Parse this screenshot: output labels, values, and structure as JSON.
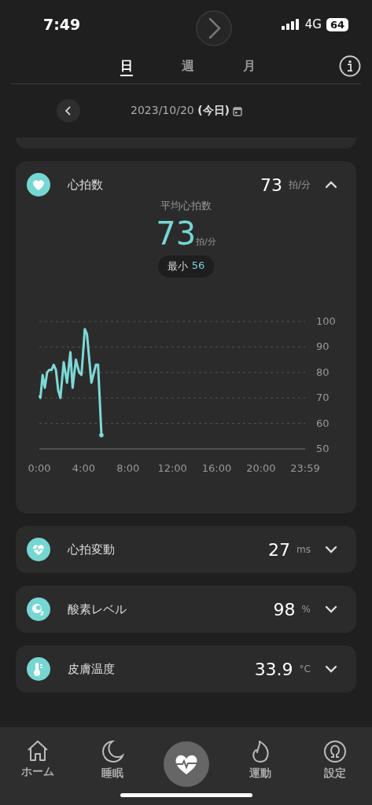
{
  "status_bar": {
    "time": "7:49",
    "network": "4G",
    "battery": "64"
  },
  "tabs": [
    {
      "label": "日",
      "selected": true
    },
    {
      "label": "週",
      "selected": false
    },
    {
      "label": "月",
      "selected": false
    }
  ],
  "date_bar": {
    "date": "2023/10/20",
    "today": "(今日)"
  },
  "metrics": [
    {
      "kind": "heart",
      "label": "心拍数",
      "value": "73",
      "unit": "拍/分",
      "expanded": true,
      "detail": {
        "title": "平均心拍数",
        "value": "73",
        "unit": "拍/分",
        "min_label": "最小",
        "min_value": "56",
        "chart_data": {
          "type": "line",
          "x": [
            0,
            0.1,
            0.3,
            0.5,
            0.7,
            0.9,
            1.1,
            1.3,
            1.5,
            1.7,
            1.9,
            2.2,
            2.5,
            2.8,
            3.0,
            3.3,
            3.6,
            3.8,
            4.1,
            4.3,
            4.7,
            5.1,
            5.3,
            5.6
          ],
          "series": [
            {
              "color": "#7dd9d6",
              "values": [
                71,
                70,
                79,
                74,
                80,
                81,
                81,
                83,
                81,
                73,
                70,
                84,
                76,
                88,
                74,
                85,
                80,
                79,
                97,
                95,
                76,
                83,
                83,
                56
              ]
            }
          ],
          "xlim": [
            0,
            23.98
          ],
          "ylim": [
            50,
            100
          ],
          "xticks": [
            {
              "value": 0,
              "label": "0:00"
            },
            {
              "value": 4,
              "label": "4:00"
            },
            {
              "value": 8,
              "label": "8:00"
            },
            {
              "value": 12,
              "label": "12:00"
            },
            {
              "value": 16,
              "label": "16:00"
            },
            {
              "value": 20,
              "label": "20:00"
            },
            {
              "value": 23.98,
              "label": "23:59"
            }
          ],
          "yticks": [
            50,
            60,
            70,
            80,
            90,
            100
          ],
          "grid": true
        }
      }
    },
    {
      "kind": "hrv",
      "label": "心拍変動",
      "value": "27",
      "unit": "ms",
      "expanded": false
    },
    {
      "kind": "oxygen",
      "label": "酸素レベル",
      "value": "98",
      "unit": "%",
      "expanded": false
    },
    {
      "kind": "temperature",
      "label": "皮膚温度",
      "value": "33.9",
      "unit": "°C",
      "expanded": false
    }
  ],
  "nav": [
    {
      "kind": "home",
      "label": "ホーム",
      "selected": false
    },
    {
      "kind": "sleep",
      "label": "睡眠",
      "selected": false
    },
    {
      "kind": "heart",
      "selected": true
    },
    {
      "kind": "exercise",
      "label": "運動",
      "selected": false
    },
    {
      "kind": "settings",
      "label": "設定",
      "selected": false
    }
  ]
}
